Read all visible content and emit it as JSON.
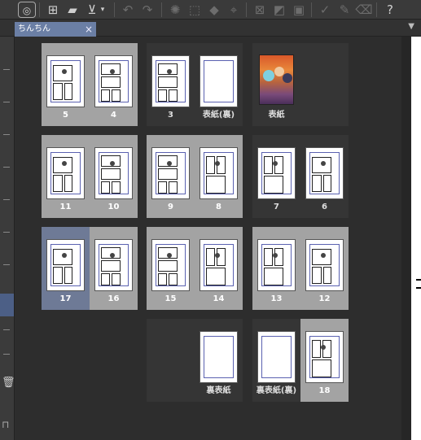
{
  "document_tab": {
    "title": "ちんちん",
    "close_glyph": "×"
  },
  "toolbar_icons": [
    "clip-logo-icon",
    "new-file-icon",
    "open-folder-icon",
    "export-icon",
    "undo-icon",
    "redo-icon",
    "loading-icon",
    "select-icon",
    "fill-icon",
    "transform-icon",
    "clear-icon",
    "invert-icon",
    "frame-icon",
    "pen-icon",
    "brush-icon",
    "eraser-icon",
    "help-icon"
  ],
  "spreads": [
    {
      "pages": [
        {
          "label": "5",
          "style": "gray"
        },
        {
          "label": "4",
          "style": "gray"
        }
      ]
    },
    {
      "pages": [
        {
          "label": "3",
          "style": "none"
        },
        {
          "label": "表紙(裏)",
          "style": "none"
        }
      ]
    },
    {
      "pages": [
        {
          "label": "表紙",
          "style": "none"
        },
        {
          "label": "",
          "style": "empty"
        }
      ]
    },
    {
      "pages": [
        {
          "label": "11",
          "style": "gray"
        },
        {
          "label": "10",
          "style": "gray"
        }
      ]
    },
    {
      "pages": [
        {
          "label": "9",
          "style": "gray"
        },
        {
          "label": "8",
          "style": "gray"
        }
      ]
    },
    {
      "pages": [
        {
          "label": "7",
          "style": "none"
        },
        {
          "label": "6",
          "style": "none"
        }
      ]
    },
    {
      "pages": [
        {
          "label": "17",
          "style": "selected"
        },
        {
          "label": "16",
          "style": "gray"
        }
      ]
    },
    {
      "pages": [
        {
          "label": "15",
          "style": "gray"
        },
        {
          "label": "14",
          "style": "gray"
        }
      ]
    },
    {
      "pages": [
        {
          "label": "13",
          "style": "gray"
        },
        {
          "label": "12",
          "style": "gray"
        }
      ]
    },
    {
      "pages": [
        {
          "label": "",
          "style": "empty"
        },
        {
          "label": "裏表紙",
          "style": "none"
        }
      ]
    },
    {
      "pages": [
        {
          "label": "裏表紙(裏)",
          "style": "none"
        },
        {
          "label": "18",
          "style": "gray"
        }
      ]
    }
  ],
  "colors": {
    "page_selected": "#6e7a96",
    "page_gray": "#a3a3a3",
    "frame_blue": "#5a61b0",
    "tab_active": "#6b7fa5"
  }
}
